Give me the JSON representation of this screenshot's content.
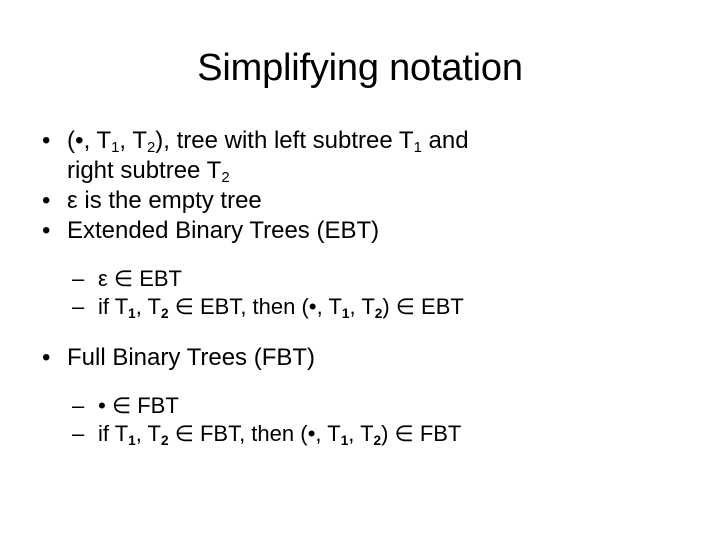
{
  "slide": {
    "title": "Simplifying notation",
    "background_color": "#ffffff",
    "text_color": "#000000",
    "bullet_marker": "•",
    "subbullet_marker": "–",
    "bullets": [
      {
        "level": 1,
        "marker": "•",
        "text": "(•, T 1, T 2), tree with left subtree T 1 and right subtree T 2",
        "parts": {
          "line1_a": "(",
          "dot": "•",
          "line1_b": ", T",
          "sub1": "1",
          "line1_c": ", T",
          "sub2": "2",
          "line1_d": "), tree with left subtree T",
          "sub3": "1",
          "line1_e": " and",
          "line2_a": "right subtree T",
          "sub4": "2"
        }
      },
      {
        "level": 1,
        "marker": "•",
        "text": " ε is the empty tree"
      },
      {
        "level": 1,
        "marker": "•",
        "text": "Extended Binary Trees (EBT)"
      },
      {
        "level": 2,
        "marker": "–",
        "text": " ε ∈ EBT"
      },
      {
        "level": 2,
        "marker": "–",
        "text": "if T 1, T 2 ∈ EBT,  then (•, T 1, T 2) ∈ EBT",
        "parts": {
          "a": "if T",
          "sub1": "1",
          "b": ", T",
          "sub2": "2",
          "c": " ∈ EBT,  then (",
          "dot": "•",
          "d": ", T",
          "sub3": "1",
          "e": ", T",
          "sub4": "2",
          "f": ") ∈ EBT"
        }
      },
      {
        "level": 1,
        "marker": "•",
        "text": "Full Binary Trees (FBT)"
      },
      {
        "level": 2,
        "marker": "–",
        "text": " • ∈ FBT",
        "parts": {
          "dot": "•",
          "rest": " ∈ FBT"
        }
      },
      {
        "level": 2,
        "marker": "–",
        "text": "if T 1, T 2 ∈ FBT,  then (•, T 1, T 2) ∈ FBT",
        "parts": {
          "a": "if T",
          "sub1": "1",
          "b": ", T",
          "sub2": "2",
          "c": " ∈ FBT,  then (",
          "dot": "•",
          "d": ", T",
          "sub3": "1",
          "e": ", T",
          "sub4": "2",
          "f": ") ∈ FBT"
        }
      }
    ]
  }
}
